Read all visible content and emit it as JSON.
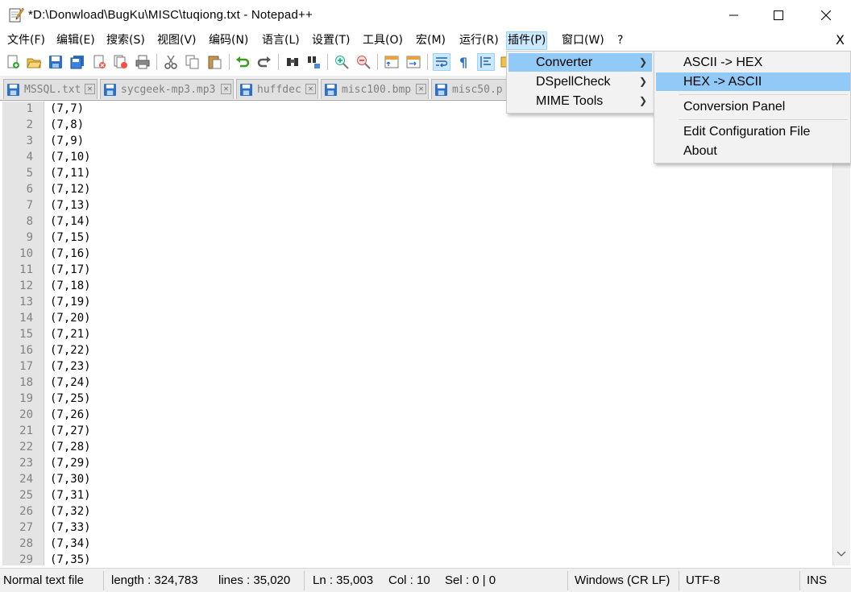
{
  "window": {
    "title": "*D:\\Donwload\\BugKu\\MISC\\tuqiong.txt - Notepad++"
  },
  "menubar": {
    "items": [
      "文件(F)",
      "编辑(E)",
      "搜索(S)",
      "视图(V)",
      "编码(N)",
      "语言(L)",
      "设置(T)",
      "工具(O)",
      "宏(M)",
      "运行(R)",
      "插件(P)",
      "窗口(W)",
      "?"
    ],
    "close_label": "X"
  },
  "tabs": [
    {
      "label": "MSSQL.txt"
    },
    {
      "label": "sycgeek-mp3.mp3"
    },
    {
      "label": "huffdec"
    },
    {
      "label": "misc100.bmp"
    },
    {
      "label": "misc50.p"
    }
  ],
  "editor": {
    "lines": [
      {
        "n": "1",
        "text": "(7,7)"
      },
      {
        "n": "2",
        "text": "(7,8)"
      },
      {
        "n": "3",
        "text": "(7,9)"
      },
      {
        "n": "4",
        "text": "(7,10)"
      },
      {
        "n": "5",
        "text": "(7,11)"
      },
      {
        "n": "6",
        "text": "(7,12)"
      },
      {
        "n": "7",
        "text": "(7,13)"
      },
      {
        "n": "8",
        "text": "(7,14)"
      },
      {
        "n": "9",
        "text": "(7,15)"
      },
      {
        "n": "10",
        "text": "(7,16)"
      },
      {
        "n": "11",
        "text": "(7,17)"
      },
      {
        "n": "12",
        "text": "(7,18)"
      },
      {
        "n": "13",
        "text": "(7,19)"
      },
      {
        "n": "14",
        "text": "(7,20)"
      },
      {
        "n": "15",
        "text": "(7,21)"
      },
      {
        "n": "16",
        "text": "(7,22)"
      },
      {
        "n": "17",
        "text": "(7,23)"
      },
      {
        "n": "18",
        "text": "(7,24)"
      },
      {
        "n": "19",
        "text": "(7,25)"
      },
      {
        "n": "20",
        "text": "(7,26)"
      },
      {
        "n": "21",
        "text": "(7,27)"
      },
      {
        "n": "22",
        "text": "(7,28)"
      },
      {
        "n": "23",
        "text": "(7,29)"
      },
      {
        "n": "24",
        "text": "(7,30)"
      },
      {
        "n": "25",
        "text": "(7,31)"
      },
      {
        "n": "26",
        "text": "(7,32)"
      },
      {
        "n": "27",
        "text": "(7,33)"
      },
      {
        "n": "28",
        "text": "(7,34)"
      },
      {
        "n": "29",
        "text": "(7,35)"
      }
    ]
  },
  "plugins_menu": {
    "items": [
      {
        "label": "Converter",
        "highlighted": true,
        "submenu": true
      },
      {
        "label": "DSpellCheck",
        "highlighted": false,
        "submenu": true
      },
      {
        "label": "MIME Tools",
        "highlighted": false,
        "submenu": true
      }
    ]
  },
  "converter_submenu": {
    "items": [
      {
        "label": "ASCII -> HEX",
        "highlighted": false
      },
      {
        "label": "HEX -> ASCII",
        "highlighted": true
      },
      {
        "label": "Conversion Panel",
        "highlighted": false
      },
      {
        "label": "Edit Configuration File",
        "highlighted": false
      },
      {
        "label": "About",
        "highlighted": false
      }
    ]
  },
  "statusbar": {
    "file_type": "Normal text file",
    "length": "length : 324,783",
    "lines": "lines : 35,020",
    "ln": "Ln : 35,003",
    "col": "Col : 10",
    "sel": "Sel : 0 | 0",
    "eol": "Windows (CR LF)",
    "encoding": "UTF-8",
    "mode": "INS"
  },
  "colors": {
    "highlight": "#91c9f7",
    "menu_active_bg": "#cce8ff",
    "gutter_bg": "#e4e4e4"
  }
}
